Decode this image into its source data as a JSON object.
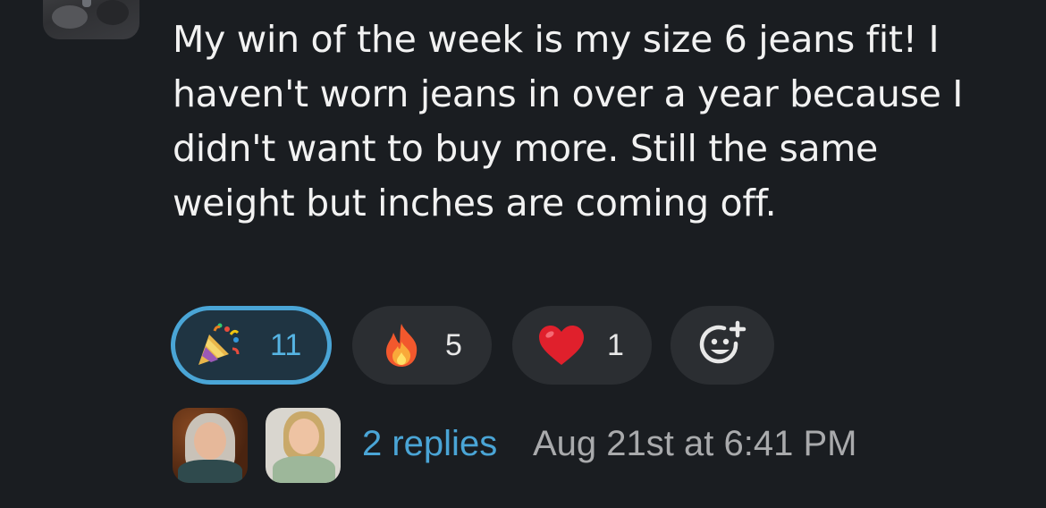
{
  "message": {
    "text": "My win of the week is my size 6 jeans fit! I haven't worn jeans in over a year because I didn't want to buy more. Still the same weight but inches are coming off."
  },
  "reactions": [
    {
      "emoji": "party-popper-icon",
      "count": "11",
      "selected": true
    },
    {
      "emoji": "fire-icon",
      "count": "5",
      "selected": false
    },
    {
      "emoji": "red-heart-icon",
      "count": "1",
      "selected": false
    }
  ],
  "add_reaction": {
    "icon": "add-reaction-icon"
  },
  "thread": {
    "replies_label": "2 replies",
    "last_reply_time": "Aug 21st at 6:41 PM"
  },
  "colors": {
    "background": "#1a1d21",
    "link": "#4aa5d6",
    "selected_reaction_border": "#4aa5d6",
    "reaction_bg": "#2b2e32",
    "timestamp": "#a9aaac"
  }
}
